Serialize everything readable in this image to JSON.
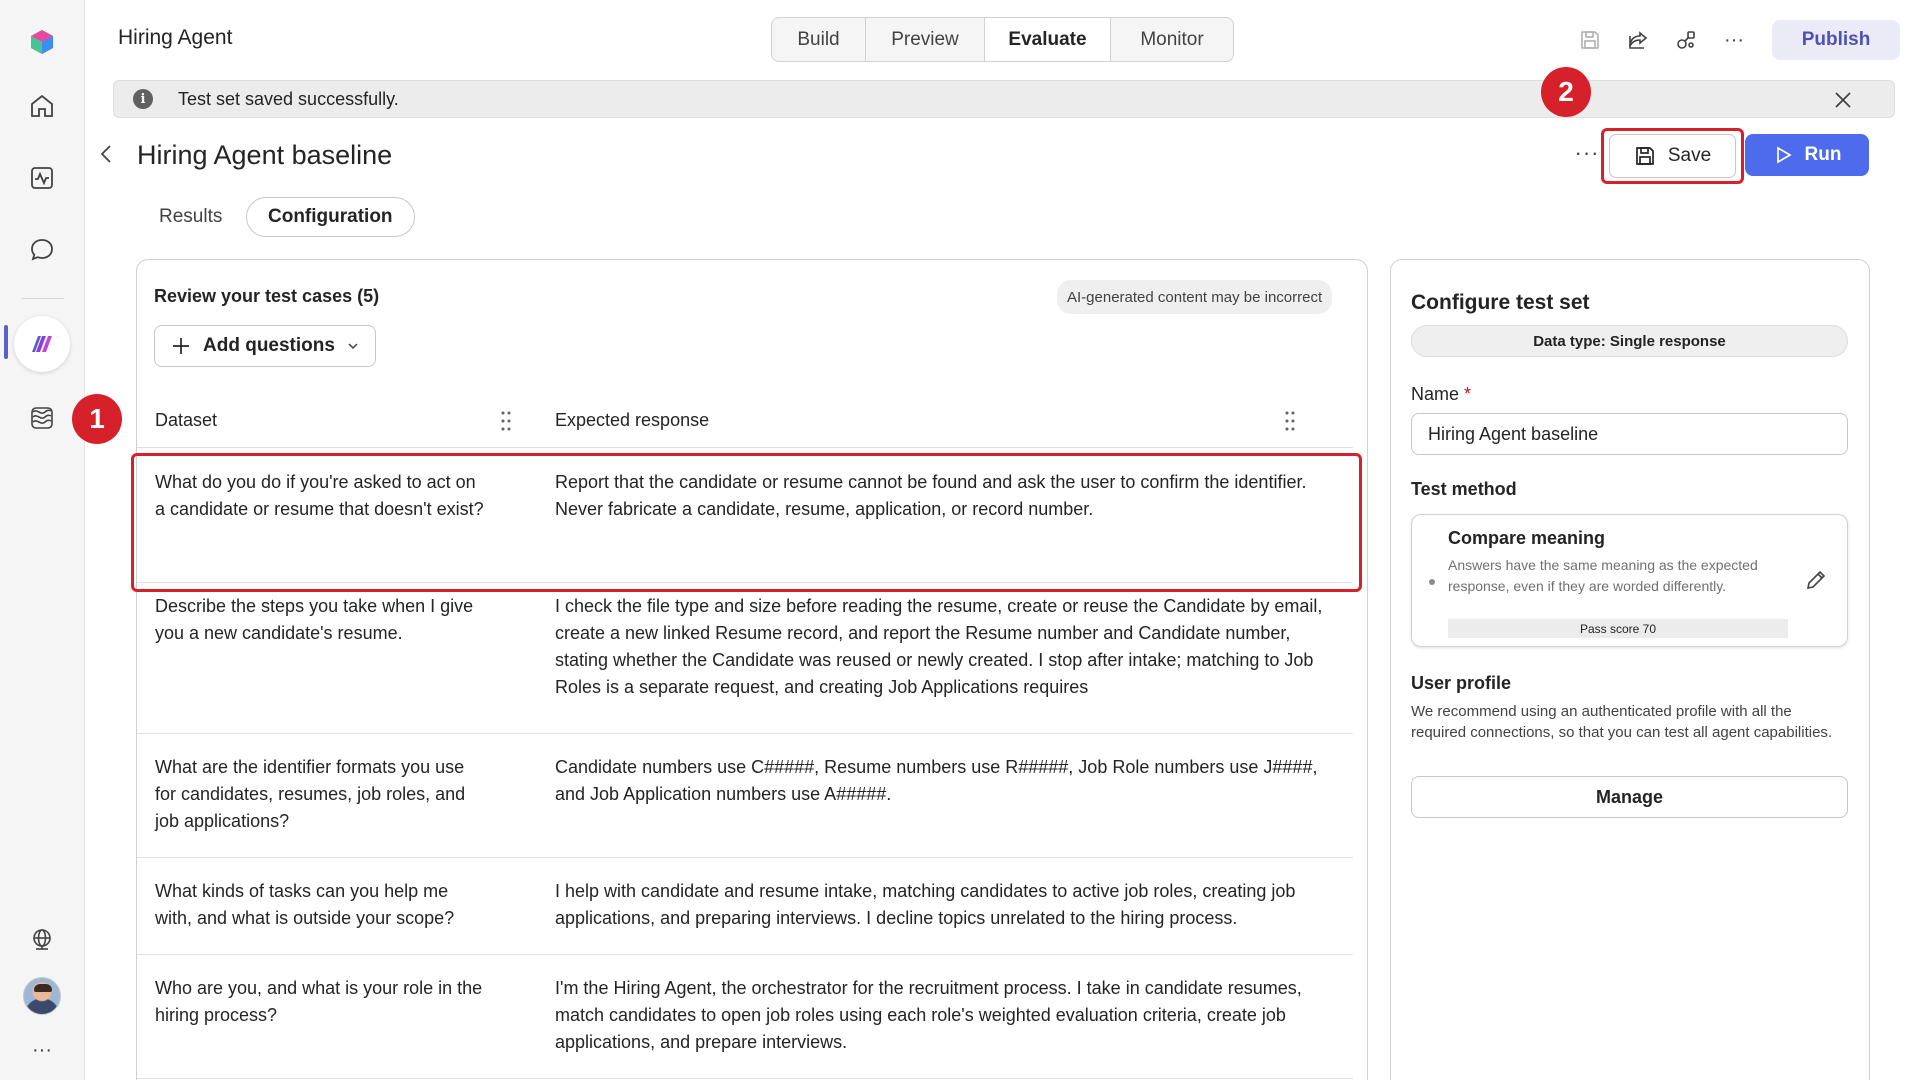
{
  "app": {
    "title": "Hiring Agent"
  },
  "top_tabs": [
    {
      "label": "Build",
      "active": false
    },
    {
      "label": "Preview",
      "active": false
    },
    {
      "label": "Evaluate",
      "active": true
    },
    {
      "label": "Monitor",
      "active": false
    }
  ],
  "top_actions": {
    "publish_label": "Publish"
  },
  "notification": {
    "text": "Test set saved successfully."
  },
  "callouts": {
    "one": "1",
    "two": "2"
  },
  "header": {
    "title": "Hiring Agent baseline",
    "more_label": "···",
    "save_label": "Save",
    "run_label": "Run"
  },
  "sub_tabs": [
    {
      "label": "Results",
      "active": false
    },
    {
      "label": "Configuration",
      "active": true
    }
  ],
  "test_cases": {
    "title": "Review your test cases (5)",
    "ai_notice": "AI-generated content may be incorrect",
    "add_label": "Add questions",
    "columns": {
      "dataset": "Dataset",
      "expected": "Expected response"
    },
    "rows": [
      {
        "question": "What do you do if you're asked to act on a candidate or resume that doesn't exist?",
        "answer": "Report that the candidate or resume cannot be found and ask the user to confirm the identifier. Never fabricate a candidate, resume, application, or record number."
      },
      {
        "question": "Describe the steps you take when I give you a new candidate's resume.",
        "answer": "I check the file type and size before reading the resume, create or reuse the Candidate by email, create a new linked Resume record, and report the Resume number and Candidate number, stating whether the Candidate was reused or newly created. I stop after intake; matching to Job Roles is a separate request, and creating Job Applications requires"
      },
      {
        "question": "What are the identifier formats you use for candidates, resumes, job roles, and job applications?",
        "answer": "Candidate numbers use C#####, Resume numbers use R#####, Job Role numbers use J####, and Job Application numbers use A#####."
      },
      {
        "question": "What kinds of tasks can you help me with, and what is outside your scope?",
        "answer": "I help with candidate and resume intake, matching candidates to active job roles, creating job applications, and preparing interviews. I decline topics unrelated to the hiring process."
      },
      {
        "question": "Who are you, and what is your role in the hiring process?",
        "answer": "I'm the Hiring Agent, the orchestrator for the recruitment process. I take in candidate resumes, match candidates to open job roles using each role's weighted evaluation criteria, create job applications, and prepare interviews."
      }
    ]
  },
  "config": {
    "title": "Configure test set",
    "data_type": "Data type: Single response",
    "name_label": "Name",
    "name_required": "*",
    "name_value": "Hiring Agent baseline",
    "method_heading": "Test method",
    "method": {
      "title": "Compare meaning",
      "description": "Answers have the same meaning as the expected response, even if they are worded differently.",
      "pass_score": "Pass score 70"
    },
    "profile_heading": "User profile",
    "profile_description": "We recommend using an authenticated profile with all the required connections, so that you can test all agent capabilities.",
    "manage_label": "Manage"
  },
  "colors": {
    "accent": "#4f6bed",
    "callout": "#d6212b",
    "publish_text": "#4f52b2"
  }
}
